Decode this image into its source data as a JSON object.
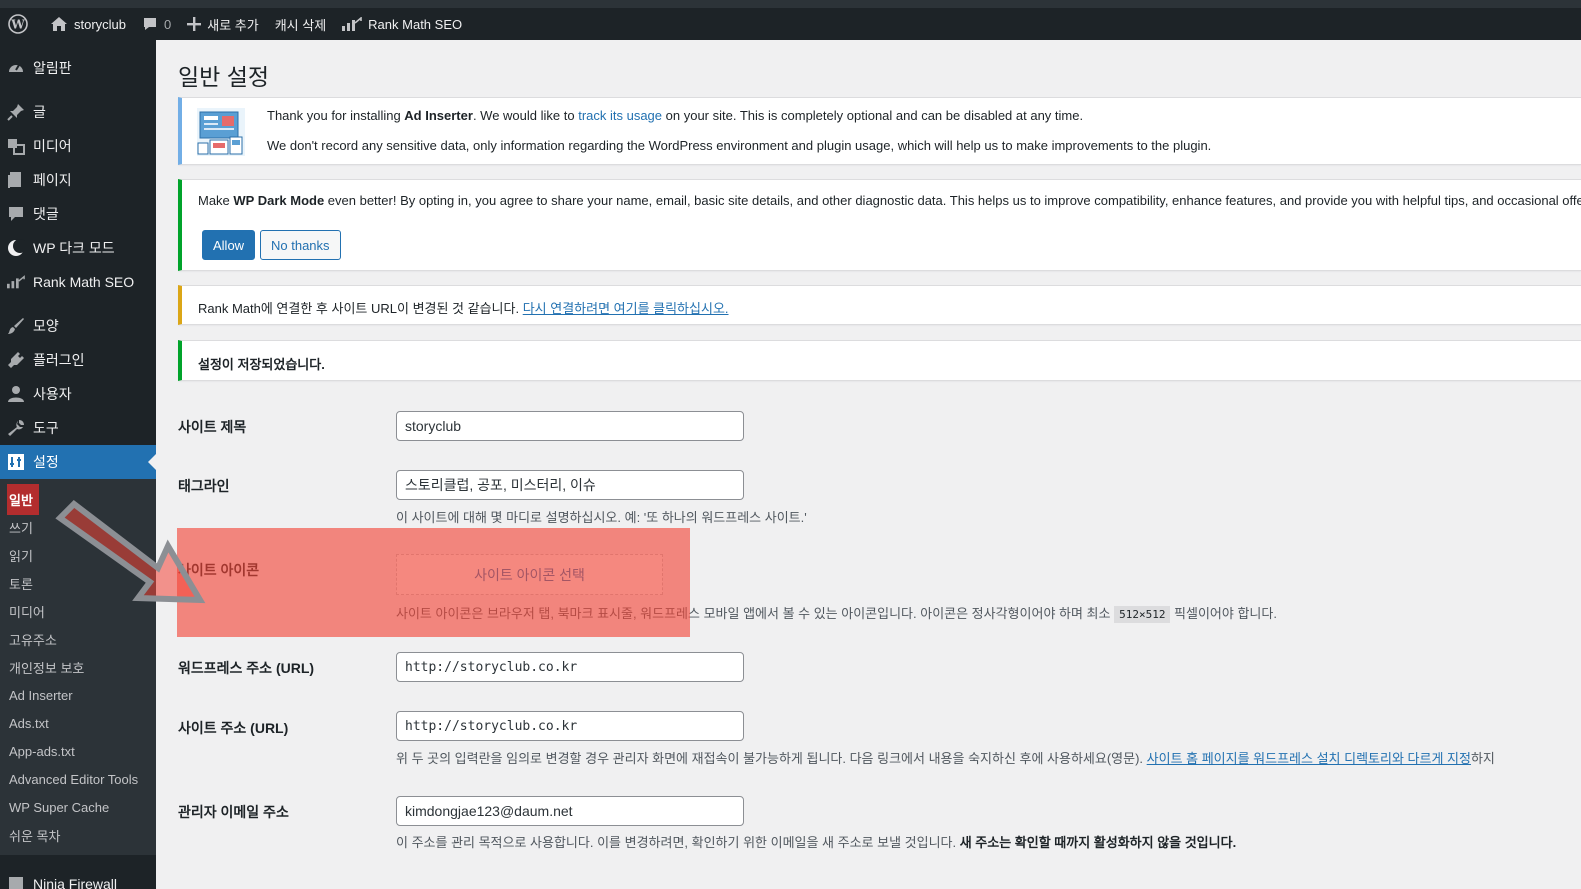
{
  "admin_bar": {
    "site_name": "storyclub",
    "comments_count": "0",
    "new_label": "새로 추가",
    "cache_label": "캐시 삭제",
    "rankmath_label": "Rank Math SEO"
  },
  "sidebar": {
    "items": [
      {
        "label": "알림판",
        "icon": "dashboard-icon"
      },
      {
        "label": "글",
        "icon": "pin-icon"
      },
      {
        "label": "미디어",
        "icon": "media-icon"
      },
      {
        "label": "페이지",
        "icon": "page-icon"
      },
      {
        "label": "댓글",
        "icon": "comment-icon"
      },
      {
        "label": "WP 다크 모드",
        "icon": "moon-icon"
      },
      {
        "label": "Rank Math SEO",
        "icon": "rankmath-icon"
      },
      {
        "label": "모양",
        "icon": "brush-icon"
      },
      {
        "label": "플러그인",
        "icon": "plugin-icon"
      },
      {
        "label": "사용자",
        "icon": "user-icon"
      },
      {
        "label": "도구",
        "icon": "wrench-icon"
      },
      {
        "label": "설정",
        "icon": "settings-icon"
      }
    ],
    "submenu": [
      "일반",
      "쓰기",
      "읽기",
      "토론",
      "미디어",
      "고유주소",
      "개인정보 보호",
      "Ad Inserter",
      "Ads.txt",
      "App-ads.txt",
      "Advanced Editor Tools",
      "WP Super Cache",
      "쉬운 목차"
    ],
    "cut_item": "Ninja Firewall"
  },
  "page": {
    "title": "일반 설정"
  },
  "notices": {
    "adinserter": {
      "line1_pre": "Thank you for installing ",
      "line1_bold": "Ad Inserter",
      "line1_mid": ". We would like to ",
      "line1_link": "track its usage",
      "line1_post": " on your site. This is completely optional and can be disabled at any time.",
      "line2": "We don't record any sensitive data, only information regarding the WordPress environment and plugin usage, which will help us to make improvements to the plugin."
    },
    "darkmode": {
      "pre": "Make ",
      "bold": "WP Dark Mode",
      "post": " even better! By opting in, you agree to share your name, email, basic site details, and other diagnostic data. This helps us to improve compatibility, enhance features, and provide you with helpful tips, and occasional offer",
      "allow": "Allow",
      "no_thanks": "No thanks"
    },
    "rankmath": {
      "text": "Rank Math에 연결한 후 사이트 URL이 변경된 것 같습니다. ",
      "link": "다시 연결하려면 여기를 클릭하십시오."
    },
    "saved": "설정이 저장되었습니다."
  },
  "form": {
    "site_title": {
      "label": "사이트 제목",
      "value": "storyclub"
    },
    "tagline": {
      "label": "태그라인",
      "value": "스토리클럽, 공포, 미스터리, 이슈",
      "desc": "이 사이트에 대해 몇 마디로 설명하십시오. 예: '또 하나의 워드프레스 사이트.'"
    },
    "site_icon": {
      "label": "사이트 아이콘",
      "button": "사이트 아이콘 선택",
      "desc_pre": "사이트 아이콘은 브라우저 탭, 북마크 표시줄, 워드프레스 모바일 앱에서 볼 수 있는 아이콘입니다. 아이콘은 정사각형이어야 하며 최소 ",
      "desc_code": "512×512",
      "desc_post": " 픽셀이어야 합니다."
    },
    "wp_url": {
      "label": "워드프레스 주소 (URL)",
      "value": "http://storyclub.co.kr"
    },
    "site_url": {
      "label": "사이트 주소 (URL)",
      "value": "http://storyclub.co.kr",
      "desc_pre": "위 두 곳의 입력란을 임의로 변경할 경우 관리자 화면에 재접속이 불가능하게 됩니다. 다음 링크에서 내용을 숙지하신 후에 사용하세요(영문). ",
      "desc_link": "사이트 홈 페이지를 워드프레스 설치 디렉토리와 다르게 지정",
      "desc_post": "하지"
    },
    "admin_email": {
      "label": "관리자 이메일 주소",
      "value": "kimdongjae123@daum.net",
      "desc_pre": "이 주소를 관리 목적으로 사용합니다. 이를 변경하려면, 확인하기 위한 이메일을 새 주소로 보낼 것입니다. ",
      "desc_bold": "새 주소는 확인할 때까지 활성화하지 않을 것입니다."
    }
  },
  "colors": {
    "admin_dark": "#1d2327",
    "accent": "#2271b1",
    "highlight": "#f44336"
  }
}
